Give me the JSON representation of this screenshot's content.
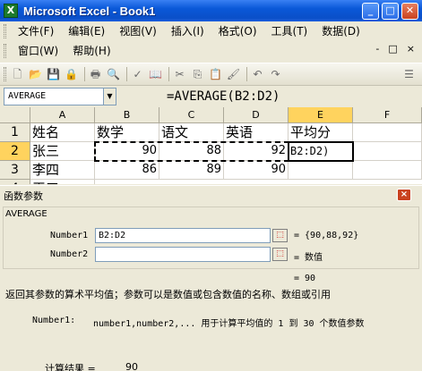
{
  "window": {
    "app_icon": "excel-icon",
    "title": "Microsoft Excel - Book1",
    "controls": {
      "minimize": "_",
      "maximize": "□",
      "close": "✕"
    }
  },
  "menu": {
    "row1": [
      "文件(F)",
      "编辑(E)",
      "视图(V)",
      "插入(I)",
      "格式(O)",
      "工具(T)",
      "数据(D)"
    ],
    "row2": [
      "窗口(W)",
      "帮助(H)"
    ],
    "doc_controls": [
      "-",
      "□",
      "×"
    ]
  },
  "toolbar": {
    "icons": [
      "new-icon",
      "open-icon",
      "save-icon",
      "permission-icon",
      "print-icon",
      "print-preview-icon",
      "spelling-icon",
      "research-icon",
      "cut-icon",
      "copy-icon",
      "paste-icon",
      "format-painter-icon",
      "undo-icon",
      "redo-icon",
      "menu-options-icon"
    ]
  },
  "formula_bar": {
    "name_box": "AVERAGE",
    "formula": "=AVERAGE(B2:D2)"
  },
  "grid": {
    "columns": [
      "A",
      "B",
      "C",
      "D",
      "E",
      "F"
    ],
    "rows": [
      "1",
      "2",
      "3",
      "4"
    ],
    "row1": [
      "姓名",
      "数学",
      "语文",
      "英语",
      "平均分"
    ],
    "row2": [
      "张三",
      "90",
      "88",
      "92",
      "B2:D2)"
    ],
    "row3": [
      "李四",
      "86",
      "89",
      "90"
    ],
    "row4": [
      "王五"
    ]
  },
  "dialog": {
    "title": "函数参数",
    "close": "×",
    "function_name": "AVERAGE",
    "arg1_label": "Number1",
    "arg1_value": "B2:D2",
    "arg1_result": "= {90,88,92}",
    "arg2_label": "Number2",
    "arg2_value": "",
    "arg2_result": "= 数值",
    "formula_result": "= 90",
    "description": "返回其参数的算术平均值；参数可以是数值或包含数值的名称、数组或引用",
    "arg_help_label": "Number1:",
    "arg_help_text": "number1,number2,... 用于计算平均值的 1 到 30 个数值参数",
    "calc_result_label": "计算结果 =",
    "calc_result_value": "90"
  }
}
